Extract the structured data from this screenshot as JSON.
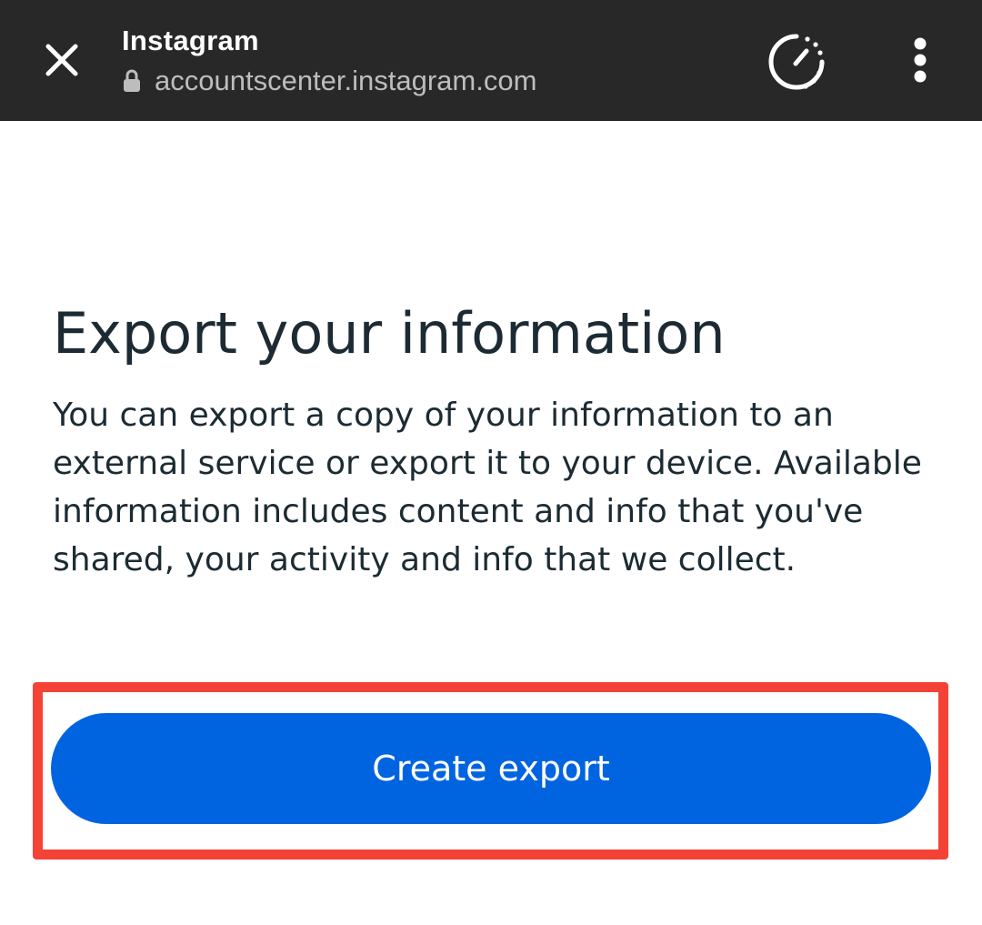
{
  "browser_bar": {
    "title": "Instagram",
    "url": "accountscenter.instagram.com",
    "icons": {
      "close": "close-icon",
      "lock": "lock-icon",
      "timer": "timer-icon",
      "menu": "more-vertical-icon"
    }
  },
  "main": {
    "heading": "Export your information",
    "description": "You can export a copy of your information to an external service or export it to your device. Available information includes content and info that you've shared, your activity and info that we collect.",
    "create_export_label": "Create export"
  },
  "colors": {
    "topbar_bg": "#282828",
    "primary_button": "#0064e0",
    "highlight_border": "#f44336",
    "heading_text": "#1c2b33"
  }
}
